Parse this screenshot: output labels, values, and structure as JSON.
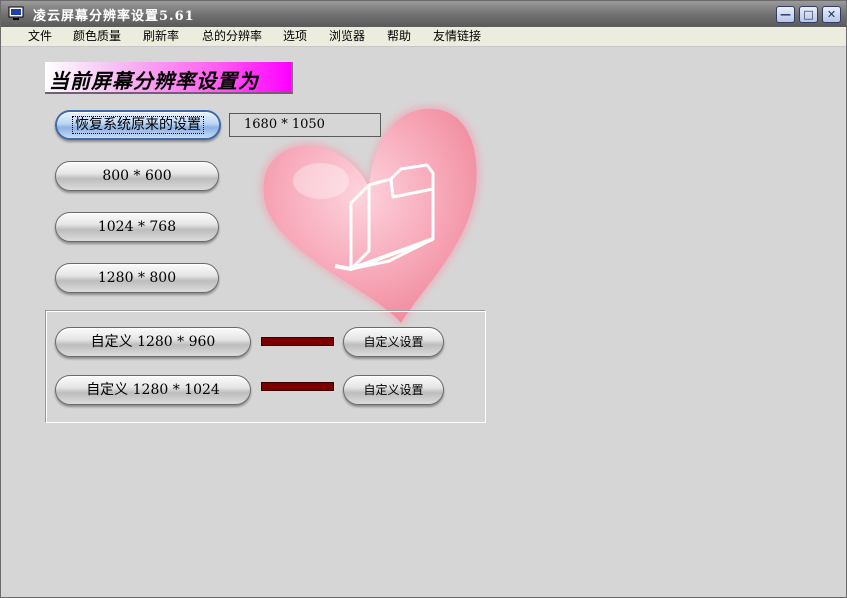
{
  "window": {
    "title": "凌云屏幕分辨率设置5.61",
    "controls": {
      "minimize": "—",
      "maximize": "□",
      "close": "✕"
    }
  },
  "menu": [
    "文件",
    "颜色质量",
    "刷新率",
    "总的分辨率",
    "选项",
    "浏览器",
    "帮助",
    "友情链接"
  ],
  "main": {
    "heading": "当前屏幕分辨率设置为",
    "restore_button": "恢复系统原来的设置",
    "current_resolution": "1680 * 1050",
    "presets": [
      "800 * 600",
      "1024 * 768",
      "1280 * 800"
    ],
    "custom": [
      {
        "label": "自定义 1280 * 960",
        "set_label": "自定义设置",
        "color": "#7a0000"
      },
      {
        "label": "自定义 1280 * 1024",
        "set_label": "自定义设置",
        "color": "#7a0000"
      }
    ]
  },
  "icons": {
    "app": "monitor-icon",
    "decoration": "heart-folder-icon"
  }
}
